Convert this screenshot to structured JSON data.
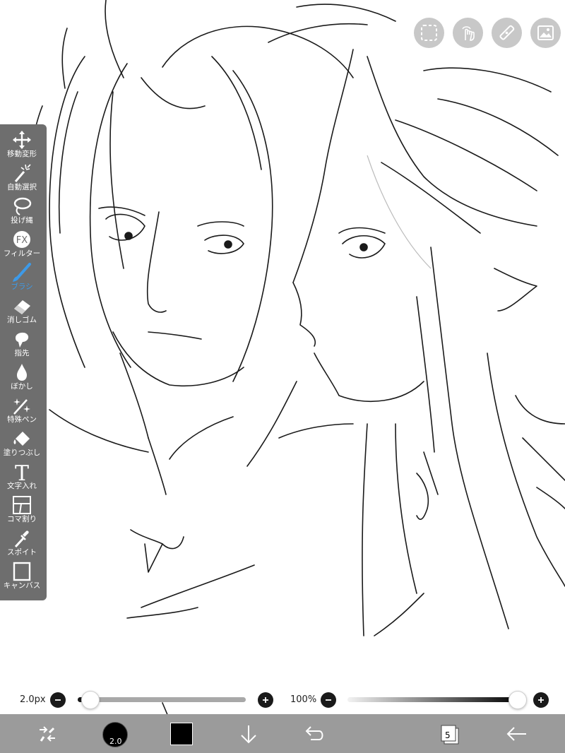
{
  "tools": [
    {
      "id": "transform",
      "label": "移動変形",
      "icon": "move-arrows-icon"
    },
    {
      "id": "magic-wand",
      "label": "自動選択",
      "icon": "magic-wand-icon"
    },
    {
      "id": "lasso",
      "label": "投げ縄",
      "icon": "lasso-icon"
    },
    {
      "id": "filter",
      "label": "フィルター",
      "icon": "fx-icon",
      "glyph": "FX"
    },
    {
      "id": "brush",
      "label": "ブラシ",
      "icon": "brush-icon",
      "active": true
    },
    {
      "id": "eraser",
      "label": "消しゴム",
      "icon": "eraser-icon"
    },
    {
      "id": "finger",
      "label": "指先",
      "icon": "finger-icon"
    },
    {
      "id": "blur",
      "label": "ぼかし",
      "icon": "blur-drop-icon"
    },
    {
      "id": "special-pen",
      "label": "特殊ペン",
      "icon": "special-pen-icon"
    },
    {
      "id": "fill",
      "label": "塗りつぶし",
      "icon": "fill-bucket-icon"
    },
    {
      "id": "text",
      "label": "文字入れ",
      "icon": "text-icon",
      "glyph": "T"
    },
    {
      "id": "frame",
      "label": "コマ割り",
      "icon": "frame-divider-icon"
    },
    {
      "id": "eyedropper",
      "label": "スポイト",
      "icon": "eyedropper-icon"
    },
    {
      "id": "canvas",
      "label": "キャンバス",
      "icon": "canvas-icon"
    }
  ],
  "top_buttons": [
    "selection-icon",
    "gesture-icon",
    "ruler-icon",
    "image-icon"
  ],
  "brush_size": {
    "label": "2.0px",
    "value": 2.0,
    "min_fraction": 0.0
  },
  "opacity": {
    "label": "100%",
    "value": 100
  },
  "bottom": {
    "brush_badge": "2.0",
    "color": "#000000",
    "layer_count": "5"
  },
  "colors": {
    "toolbar": "#6e6e6e",
    "bottombar": "#9b9b9b",
    "accent": "#3d9ae8",
    "slider_fill": "#1a1a1a"
  }
}
